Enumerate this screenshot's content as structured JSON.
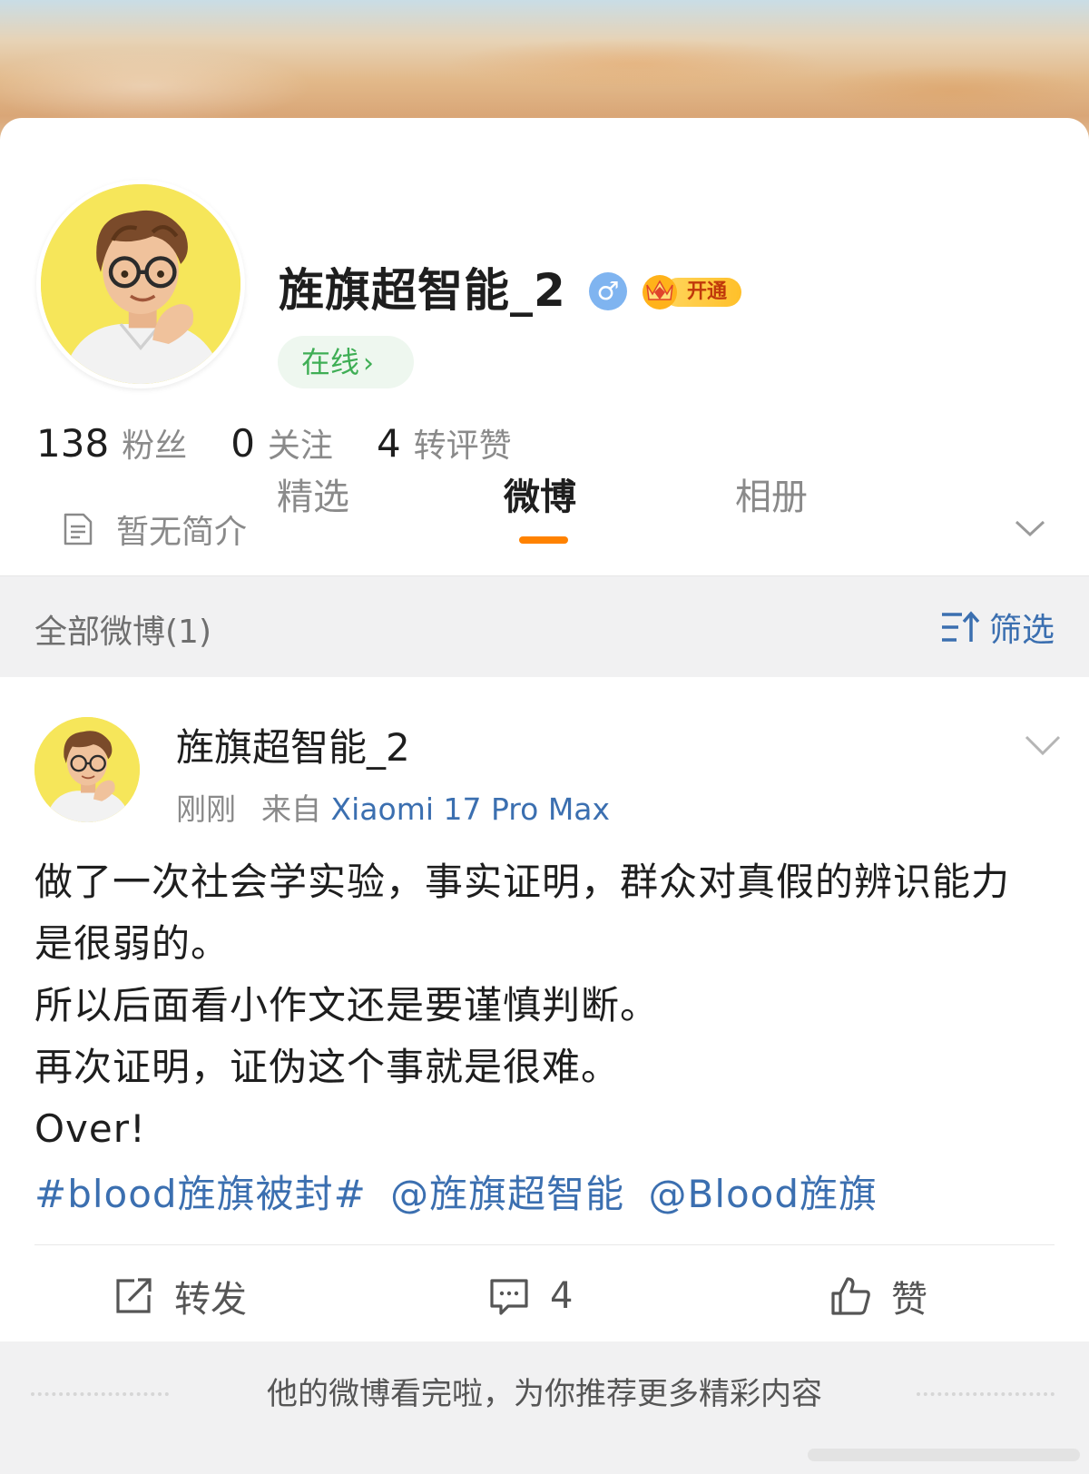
{
  "profile": {
    "name": "旌旗超智能_2",
    "gender_icon": "male-icon",
    "vip_label": "开通",
    "online_label": "在线",
    "stats": [
      {
        "value": "138",
        "label": "粉丝"
      },
      {
        "value": "0",
        "label": "关注"
      },
      {
        "value": "4",
        "label": "转评赞"
      }
    ],
    "intro": "暂无简介"
  },
  "tabs": [
    {
      "label": "精选",
      "active": false
    },
    {
      "label": "微博",
      "active": true
    },
    {
      "label": "相册",
      "active": false
    }
  ],
  "filter_bar": {
    "all_posts": "全部微博(1)",
    "filter_label": "筛选"
  },
  "post": {
    "author": "旌旗超智能_2",
    "time": "刚刚",
    "source_prefix": "来自",
    "source": "Xiaomi 17 Pro Max",
    "lines": [
      "做了一次社会学实验，事实证明，群众对真假的辨识能力",
      "是很弱的。",
      "所以后面看小作文还是要谨慎判断。",
      "再次证明，证伪这个事就是很难。",
      "Over!"
    ],
    "tags": [
      "#blood旌旗被封#",
      "@旌旗超智能",
      "@Blood旌旗"
    ],
    "actions": {
      "repost": "转发",
      "comment_count": "4",
      "like": "赞"
    }
  },
  "footer": {
    "message": "他的微博看完啦，为你推荐更多精彩内容"
  },
  "colors": {
    "accent_orange": "#ff8200",
    "link_blue": "#3b6fb0",
    "online_green": "#3fae55",
    "gender_blue": "#7fb4f0"
  }
}
